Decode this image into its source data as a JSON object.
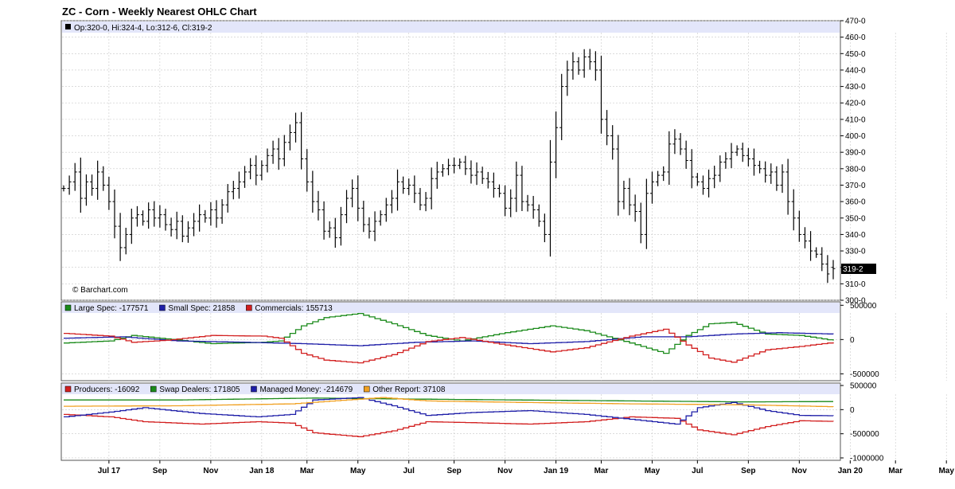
{
  "title": "ZC - Corn - Weekly Nearest OHLC Chart",
  "watermark": "© Barchart.com",
  "price_panel": {
    "legend": "Op:320-0, Hi:324-4, Lo:312-6, Cl:319-2",
    "last_label": "319-2",
    "y_ticks": [
      "300-0",
      "310-0",
      "320-0",
      "330-0",
      "340-0",
      "350-0",
      "360-0",
      "370-0",
      "380-0",
      "390-0",
      "400-0",
      "410-0",
      "420-0",
      "430-0",
      "440-0",
      "450-0",
      "460-0",
      "470-0"
    ]
  },
  "cot_panel": {
    "legend": [
      {
        "label": "Large Spec: -177571",
        "color": "#1a8a1a"
      },
      {
        "label": "Small Spec: 21858",
        "color": "#1f1fa8"
      },
      {
        "label": "Commercials: 155713",
        "color": "#d21f1f"
      }
    ],
    "y_ticks": [
      "500000",
      "0",
      "-500000"
    ]
  },
  "disagg_panel": {
    "legend": [
      {
        "label": "Producers: -16092",
        "color": "#d21f1f"
      },
      {
        "label": "Swap Dealers: 171805",
        "color": "#1a8a1a"
      },
      {
        "label": "Managed Money: -214679",
        "color": "#1f1fa8"
      },
      {
        "label": "Other Report: 37108",
        "color": "#f0a020"
      }
    ],
    "y_ticks": [
      "500000",
      "0",
      "-500000",
      "-1000000"
    ]
  },
  "x_ticks": [
    "Jul 17",
    "Sep",
    "Nov",
    "Jan 18",
    "Mar",
    "May",
    "Jul",
    "Sep",
    "Nov",
    "Jan 19",
    "Mar",
    "May",
    "Jul",
    "Sep",
    "Nov",
    "Jan 20",
    "Mar",
    "May"
  ],
  "colors": {
    "header_bg": "#e3e6fa",
    "grid": "#c8c8c8",
    "bar": "#000000"
  },
  "chart_data": [
    {
      "type": "ohlc",
      "title": "ZC - Corn - Weekly Nearest OHLC Chart",
      "x_labels": [
        "Jul 17",
        "Sep",
        "Nov",
        "Jan 18",
        "Mar",
        "May",
        "Jul",
        "Sep",
        "Nov",
        "Jan 19",
        "Mar",
        "May",
        "Jul",
        "Sep",
        "Nov",
        "Jan 20",
        "Mar",
        "May"
      ],
      "x_label_week_index": [
        8,
        17,
        26,
        35,
        43,
        52,
        61,
        69,
        78,
        87,
        95,
        104,
        112,
        121,
        130,
        139,
        147,
        156
      ],
      "ylim": [
        300,
        470
      ],
      "grid": true,
      "close_approx": [
        368,
        372,
        378,
        362,
        372,
        368,
        378,
        370,
        360,
        345,
        332,
        340,
        350,
        352,
        348,
        355,
        350,
        352,
        346,
        343,
        348,
        339,
        344,
        348,
        352,
        350,
        355,
        350,
        358,
        366,
        368,
        372,
        378,
        382,
        376,
        382,
        388,
        392,
        386,
        396,
        402,
        408,
        386,
        372,
        360,
        355,
        342,
        344,
        338,
        352,
        362,
        368,
        356,
        346,
        342,
        348,
        352,
        358,
        362,
        372,
        368,
        370,
        365,
        358,
        362,
        374,
        378,
        380,
        382,
        382,
        384,
        380,
        376,
        378,
        374,
        372,
        368,
        365,
        356,
        362,
        376,
        360,
        358,
        355,
        348,
        340,
        384,
        405,
        430,
        440,
        445,
        440,
        448,
        445,
        440,
        410,
        400,
        392,
        360,
        368,
        358,
        354,
        340,
        365,
        372,
        376,
        378,
        395,
        398,
        392,
        385,
        375,
        372,
        368,
        374,
        376,
        384,
        386,
        390,
        392,
        388,
        386,
        382,
        380,
        376,
        378,
        370,
        378,
        360,
        350,
        340,
        336,
        330,
        328,
        322,
        316,
        319
      ],
      "last": {
        "open": 320.0,
        "high": 324.5,
        "low": 312.75,
        "close": 319.25
      }
    },
    {
      "type": "line",
      "x_labels": [
        "Jul 17",
        "Sep",
        "Nov",
        "Jan 18",
        "Mar",
        "May",
        "Jul",
        "Sep",
        "Nov",
        "Jan 19",
        "Mar",
        "May",
        "Jul",
        "Sep",
        "Nov",
        "Jan 20",
        "Mar",
        "May"
      ],
      "ylim": [
        -600000,
        550000
      ],
      "series": [
        {
          "name": "Large Spec",
          "color": "#1a8a1a",
          "last": -177571,
          "keypoints": [
            [
              0,
              -50000
            ],
            [
              8,
              -20000
            ],
            [
              12,
              60000
            ],
            [
              18,
              10000
            ],
            [
              26,
              -60000
            ],
            [
              35,
              -40000
            ],
            [
              38,
              -20000
            ],
            [
              42,
              200000
            ],
            [
              46,
              320000
            ],
            [
              52,
              380000
            ],
            [
              58,
              230000
            ],
            [
              64,
              60000
            ],
            [
              70,
              -20000
            ],
            [
              78,
              100000
            ],
            [
              86,
              200000
            ],
            [
              92,
              130000
            ],
            [
              100,
              -50000
            ],
            [
              106,
              -200000
            ],
            [
              110,
              60000
            ],
            [
              114,
              230000
            ],
            [
              118,
              250000
            ],
            [
              124,
              80000
            ],
            [
              130,
              60000
            ],
            [
              138,
              -40000
            ],
            [
              142,
              20000
            ],
            [
              150,
              40000
            ],
            [
              156,
              -177571
            ]
          ]
        },
        {
          "name": "Small Spec",
          "color": "#1f1fa8",
          "last": 21858,
          "keypoints": [
            [
              0,
              20000
            ],
            [
              10,
              40000
            ],
            [
              20,
              -20000
            ],
            [
              32,
              -40000
            ],
            [
              42,
              -60000
            ],
            [
              52,
              -90000
            ],
            [
              62,
              -40000
            ],
            [
              72,
              -20000
            ],
            [
              82,
              -60000
            ],
            [
              92,
              -30000
            ],
            [
              102,
              40000
            ],
            [
              110,
              40000
            ],
            [
              118,
              80000
            ],
            [
              126,
              100000
            ],
            [
              136,
              80000
            ],
            [
              146,
              60000
            ],
            [
              156,
              21858
            ]
          ]
        },
        {
          "name": "Commercials",
          "color": "#d21f1f",
          "last": 155713,
          "keypoints": [
            [
              0,
              90000
            ],
            [
              8,
              50000
            ],
            [
              12,
              -40000
            ],
            [
              18,
              -10000
            ],
            [
              26,
              60000
            ],
            [
              35,
              50000
            ],
            [
              38,
              20000
            ],
            [
              42,
              -200000
            ],
            [
              46,
              -300000
            ],
            [
              52,
              -340000
            ],
            [
              58,
              -220000
            ],
            [
              64,
              -30000
            ],
            [
              70,
              30000
            ],
            [
              78,
              -80000
            ],
            [
              86,
              -180000
            ],
            [
              92,
              -120000
            ],
            [
              100,
              50000
            ],
            [
              106,
              150000
            ],
            [
              110,
              -80000
            ],
            [
              114,
              -270000
            ],
            [
              118,
              -330000
            ],
            [
              124,
              -150000
            ],
            [
              130,
              -100000
            ],
            [
              138,
              -20000
            ],
            [
              142,
              -60000
            ],
            [
              150,
              -30000
            ],
            [
              156,
              155713
            ]
          ]
        }
      ]
    },
    {
      "type": "line",
      "x_labels": [
        "Jul 17",
        "Sep",
        "Nov",
        "Jan 18",
        "Mar",
        "May",
        "Jul",
        "Sep",
        "Nov",
        "Jan 19",
        "Mar",
        "May",
        "Jul",
        "Sep",
        "Nov",
        "Jan 20",
        "Mar",
        "May"
      ],
      "ylim": [
        -1050000,
        550000
      ],
      "series": [
        {
          "name": "Producers",
          "color": "#d21f1f",
          "last": -16092,
          "keypoints": [
            [
              0,
              -100000
            ],
            [
              8,
              -150000
            ],
            [
              14,
              -250000
            ],
            [
              24,
              -300000
            ],
            [
              34,
              -250000
            ],
            [
              40,
              -280000
            ],
            [
              44,
              -480000
            ],
            [
              52,
              -560000
            ],
            [
              58,
              -440000
            ],
            [
              64,
              -250000
            ],
            [
              72,
              -270000
            ],
            [
              82,
              -300000
            ],
            [
              92,
              -250000
            ],
            [
              100,
              -150000
            ],
            [
              108,
              -180000
            ],
            [
              112,
              -420000
            ],
            [
              118,
              -520000
            ],
            [
              124,
              -350000
            ],
            [
              130,
              -230000
            ],
            [
              138,
              -250000
            ],
            [
              146,
              -280000
            ],
            [
              152,
              -120000
            ],
            [
              156,
              -16092
            ]
          ]
        },
        {
          "name": "Swap Dealers",
          "color": "#1a8a1a",
          "last": 171805,
          "keypoints": [
            [
              0,
              200000
            ],
            [
              20,
              200000
            ],
            [
              44,
              240000
            ],
            [
              60,
              220000
            ],
            [
              80,
              200000
            ],
            [
              100,
              180000
            ],
            [
              120,
              160000
            ],
            [
              140,
              170000
            ],
            [
              156,
              171805
            ]
          ]
        },
        {
          "name": "Managed Money",
          "color": "#1f1fa8",
          "last": -214679,
          "keypoints": [
            [
              0,
              -150000
            ],
            [
              8,
              -50000
            ],
            [
              14,
              40000
            ],
            [
              24,
              -80000
            ],
            [
              34,
              -150000
            ],
            [
              40,
              -100000
            ],
            [
              44,
              200000
            ],
            [
              52,
              250000
            ],
            [
              58,
              80000
            ],
            [
              64,
              -120000
            ],
            [
              72,
              -60000
            ],
            [
              82,
              -20000
            ],
            [
              92,
              -100000
            ],
            [
              100,
              -200000
            ],
            [
              108,
              -300000
            ],
            [
              112,
              40000
            ],
            [
              118,
              150000
            ],
            [
              124,
              -20000
            ],
            [
              130,
              -120000
            ],
            [
              138,
              -130000
            ],
            [
              146,
              -100000
            ],
            [
              152,
              -150000
            ],
            [
              156,
              -214679
            ]
          ]
        },
        {
          "name": "Other Report",
          "color": "#f0a020",
          "last": 37108,
          "keypoints": [
            [
              0,
              70000
            ],
            [
              20,
              80000
            ],
            [
              40,
              120000
            ],
            [
              56,
              250000
            ],
            [
              64,
              180000
            ],
            [
              80,
              150000
            ],
            [
              100,
              120000
            ],
            [
              120,
              100000
            ],
            [
              140,
              50000
            ],
            [
              156,
              37108
            ]
          ]
        }
      ]
    }
  ]
}
